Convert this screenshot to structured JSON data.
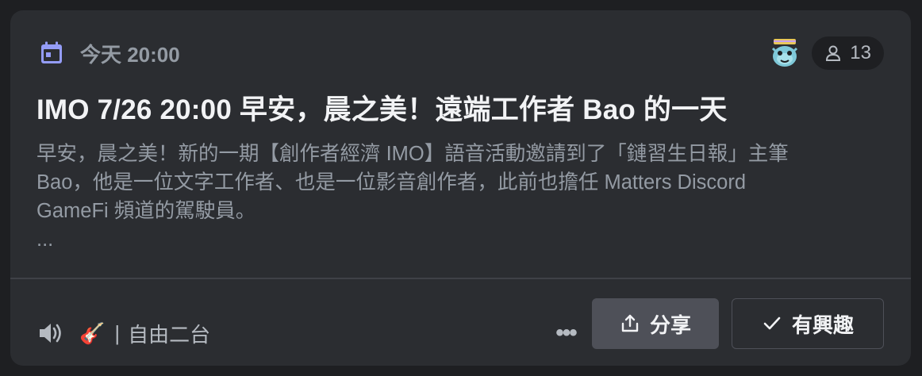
{
  "event": {
    "time": "今天 20:00",
    "interested_count": "13",
    "title": "IMO 7/26 20:00 早安，晨之美！遠端工作者 Bao 的一天",
    "description": "早安，晨之美！新的一期【創作者經濟 IMO】語音活動邀請到了「鏈習生日報」主筆\nBao，他是一位文字工作者、也是一位影音創作者，此前也擔任 Matters Discord\nGameFi 頻道的駕駛員。\n...",
    "location_emoji": "🎸",
    "location_separator": "|",
    "location_name": "自由二台"
  },
  "actions": {
    "more_label": "•••",
    "share_label": "分享",
    "interest_label": "有興趣"
  },
  "icons": {
    "calendar": "calendar-icon",
    "avatar": "user-avatar",
    "people": "people-icon",
    "speaker": "speaker-icon",
    "share": "share-icon",
    "check": "check-icon"
  },
  "colors": {
    "accent": "#949cf7",
    "card_bg": "#2b2d31",
    "page_bg": "#1e1f22",
    "muted_text": "#949ba4",
    "button_bg": "#4e5058"
  }
}
